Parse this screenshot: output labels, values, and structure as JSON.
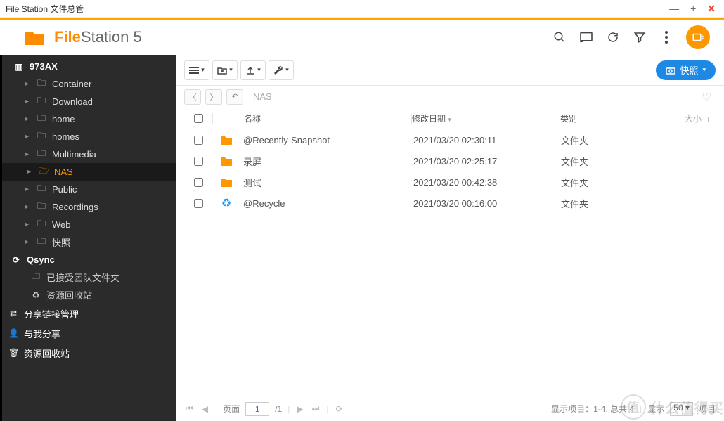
{
  "window": {
    "title": "File Station 文件总管"
  },
  "app": {
    "name_bold": "File",
    "name_rest": "Station 5"
  },
  "toolbar": {
    "snapshot_label": "快照"
  },
  "breadcrumb": {
    "path": "NAS"
  },
  "sidebar": {
    "root": "973AX",
    "folders": [
      "Container",
      "Download",
      "home",
      "homes",
      "Multimedia",
      "NAS",
      "Public",
      "Recordings",
      "Web",
      "快照"
    ],
    "selected": "NAS",
    "qsync": {
      "label": "Qsync",
      "items": [
        "已接受团队文件夹",
        "资源回收站"
      ]
    },
    "sections": [
      "分享链接管理",
      "与我分享",
      "资源回收站"
    ]
  },
  "columns": {
    "name": "名称",
    "date": "修改日期",
    "type": "类别",
    "size": "大小"
  },
  "rows": [
    {
      "icon": "folder",
      "name": "@Recently-Snapshot",
      "date": "2021/03/20 02:30:11",
      "type": "文件夹"
    },
    {
      "icon": "folder",
      "name": "录屏",
      "date": "2021/03/20 02:25:17",
      "type": "文件夹"
    },
    {
      "icon": "folder",
      "name": "测试",
      "date": "2021/03/20 00:42:38",
      "type": "文件夹"
    },
    {
      "icon": "recycle",
      "name": "@Recycle",
      "date": "2021/03/20 00:16:00",
      "type": "文件夹"
    }
  ],
  "footer": {
    "page_label": "页面",
    "page_current": "1",
    "page_total": "/1",
    "items_label_prefix": "显示项目：",
    "items_range": "1-4, 总共 4",
    "show_label": "显示",
    "page_size": "50",
    "suffix": "项目"
  },
  "watermark": "什么值得买"
}
